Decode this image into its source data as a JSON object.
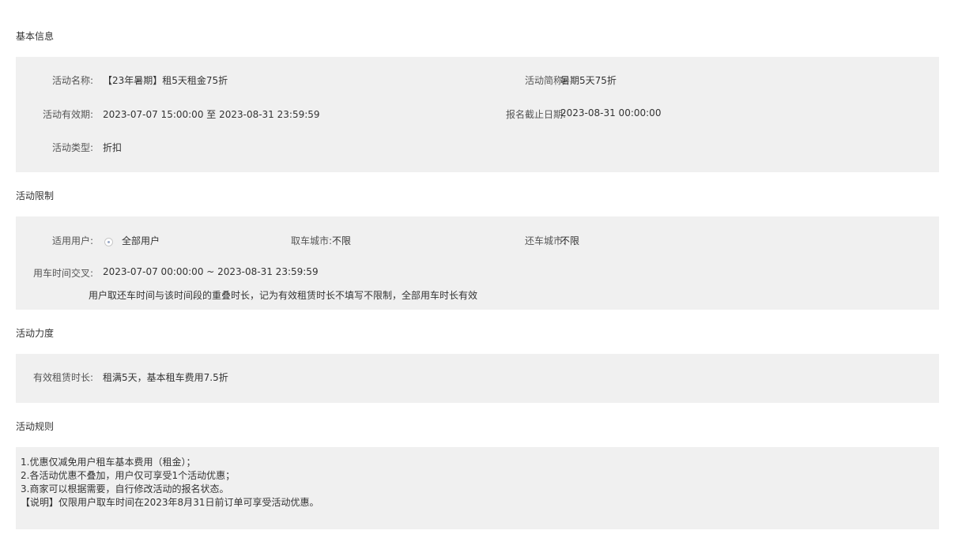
{
  "basic": {
    "title": "基本信息",
    "name_label": "活动名称:",
    "name_value": "【23年暑期】租5天租金75折",
    "short_label": "活动简称:",
    "short_value": "暑期5天75折",
    "period_label": "活动有效期:",
    "period_value": "2023-07-07 15:00:00 至 2023-08-31 23:59:59",
    "deadline_label": "报名截止日期:",
    "deadline_value": "2023-08-31 00:00:00",
    "type_label": "活动类型:",
    "type_value": "折扣"
  },
  "limits": {
    "title": "活动限制",
    "users_label": "适用用户:",
    "users_value": "全部用户",
    "pickup_label": "取车城市:",
    "pickup_value": "不限",
    "return_label": "还车城市:",
    "return_value": "不限",
    "overlap_label": "用车时间交叉:",
    "overlap_value": "2023-07-07 00:00:00 ~ 2023-08-31 23:59:59",
    "overlap_hint": "用户取还车时间与该时间段的重叠时长，记为有效租赁时长不填写不限制，全部用车时长有效"
  },
  "strength": {
    "title": "活动力度",
    "duration_label": "有效租赁时长:",
    "duration_value": "租满5天，基本租车费用7.5折"
  },
  "rules": {
    "title": "活动规则",
    "lines": [
      "1.优惠仅减免用户租车基本费用（租金）；",
      "2.各活动优惠不叠加，用户仅可享受1个活动优惠；",
      "3.商家可以根据需要，自行修改活动的报名状态。",
      "【说明】仅限用户取车时间在2023年8月31日前订单可享受活动优惠。"
    ]
  }
}
